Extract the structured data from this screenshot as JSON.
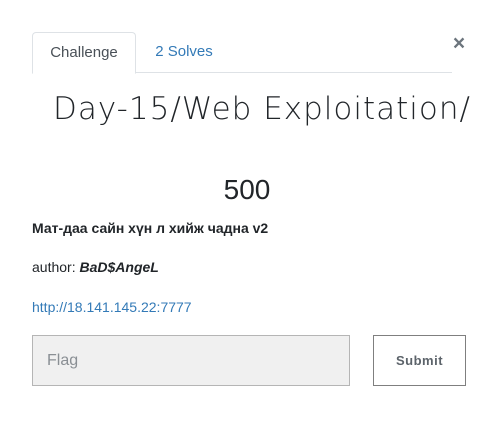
{
  "tabs": [
    {
      "label": "Challenge",
      "active": true
    },
    {
      "label": "2 Solves",
      "active": false
    }
  ],
  "close_label": "×",
  "challenge": {
    "title": "Day-15/Web Exploitation/",
    "value": "500",
    "description": "Мат-даа сайн хүн л хийж чадна v2",
    "author_label": "author:",
    "author_name": "BaD$AngeL",
    "link": "http://18.141.145.22:7777"
  },
  "form": {
    "flag_placeholder": "Flag",
    "flag_value": "",
    "submit_label": "Submit"
  },
  "colors": {
    "link": "#337ab7",
    "text": "#212529",
    "input_bg": "#f0f0f0"
  }
}
